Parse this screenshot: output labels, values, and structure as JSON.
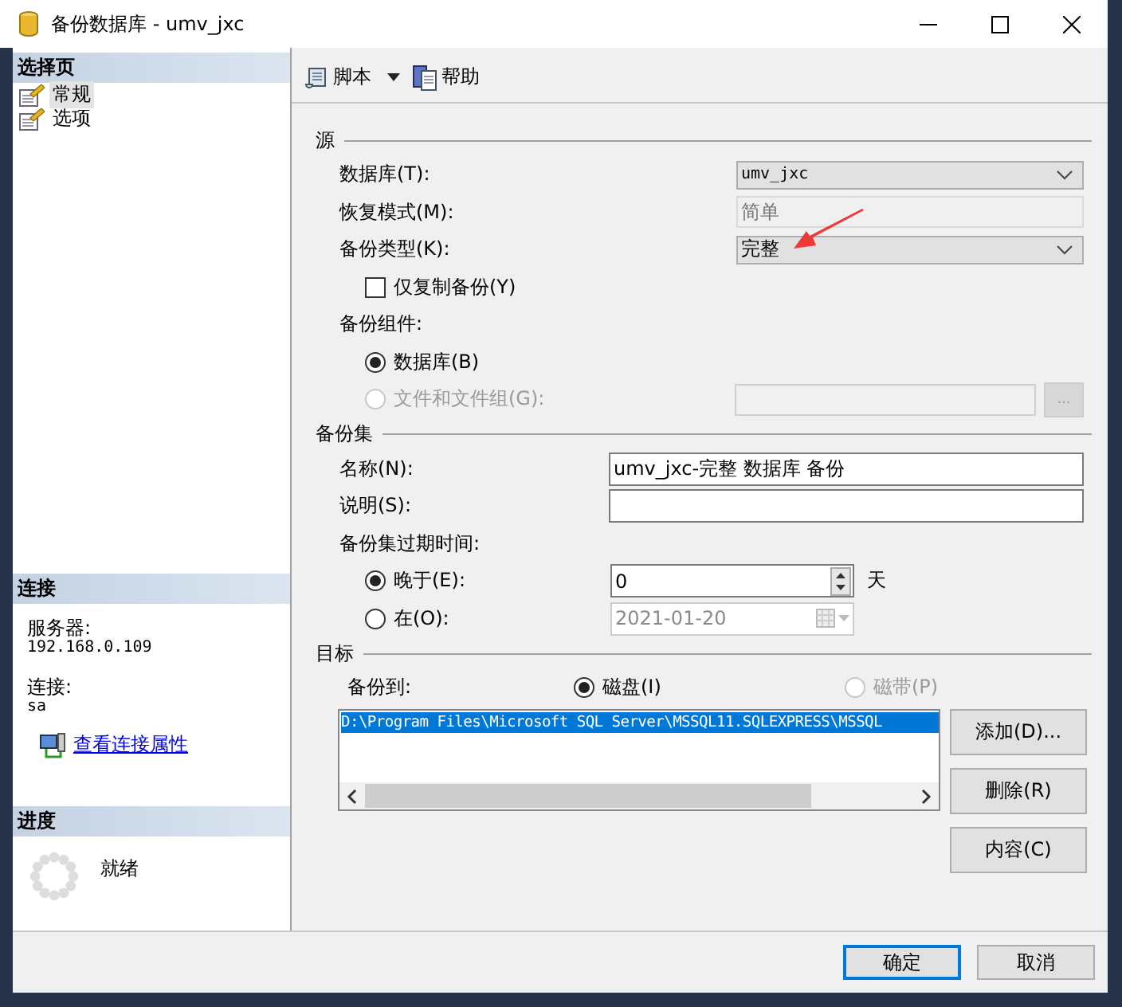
{
  "window": {
    "title": "备份数据库 - umv_jxc"
  },
  "sidebar": {
    "select_page": {
      "title": "选择页",
      "items": [
        {
          "label": "常规",
          "selected": true
        },
        {
          "label": "选项",
          "selected": false
        }
      ]
    },
    "connection": {
      "title": "连接",
      "server_label": "服务器:",
      "server": "192.168.0.109",
      "user_label": "连接:",
      "user": "sa",
      "link": "查看连接属性"
    },
    "progress": {
      "title": "进度",
      "status": "就绪"
    }
  },
  "toolbar": [
    {
      "label": "脚本",
      "kind": "script"
    },
    {
      "label": "帮助",
      "kind": "help"
    }
  ],
  "source": {
    "title": "源",
    "database": {
      "label": "数据库(T):",
      "value": "umv_jxc"
    },
    "recovery_model": {
      "label": "恢复模式(M):",
      "value": "简单"
    },
    "backup_type": {
      "label": "备份类型(K):",
      "value": "完整"
    },
    "copy_only": {
      "label": "仅复制备份(Y)",
      "checked": false
    },
    "component_label": "备份组件:",
    "components": [
      {
        "label": "数据库(B)",
        "selected": true,
        "disabled": false
      },
      {
        "label": "文件和文件组(G):",
        "selected": false,
        "disabled": true
      }
    ],
    "files_button": "..."
  },
  "backup_set": {
    "title": "备份集",
    "name": {
      "label": "名称(N):",
      "value": "umv_jxc-完整 数据库 备份"
    },
    "description": {
      "label": "说明(S):"
    },
    "expire_label": "备份集过期时间:",
    "after": {
      "label": "晚于(E):",
      "selected": true,
      "value": "0",
      "unit": "天"
    },
    "on": {
      "label": "在(O):",
      "selected": false,
      "value": "2021-01-20"
    }
  },
  "destination": {
    "title": "目标",
    "backup_to_label": "备份到:",
    "media": [
      {
        "label": "磁盘(I)",
        "selected": true,
        "disabled": false
      },
      {
        "label": "磁带(P)",
        "selected": false,
        "disabled": true
      }
    ],
    "paths": [
      {
        "text": "D:\\Program Files\\Microsoft SQL Server\\MSSQL11.SQLEXPRESS\\MSSQL",
        "selected": true
      }
    ],
    "buttons": [
      "添加(D)...",
      "删除(R)",
      "内容(C)"
    ]
  },
  "footer_buttons": [
    {
      "label": "确定",
      "focused": true
    },
    {
      "label": "取消",
      "focused": false
    }
  ]
}
